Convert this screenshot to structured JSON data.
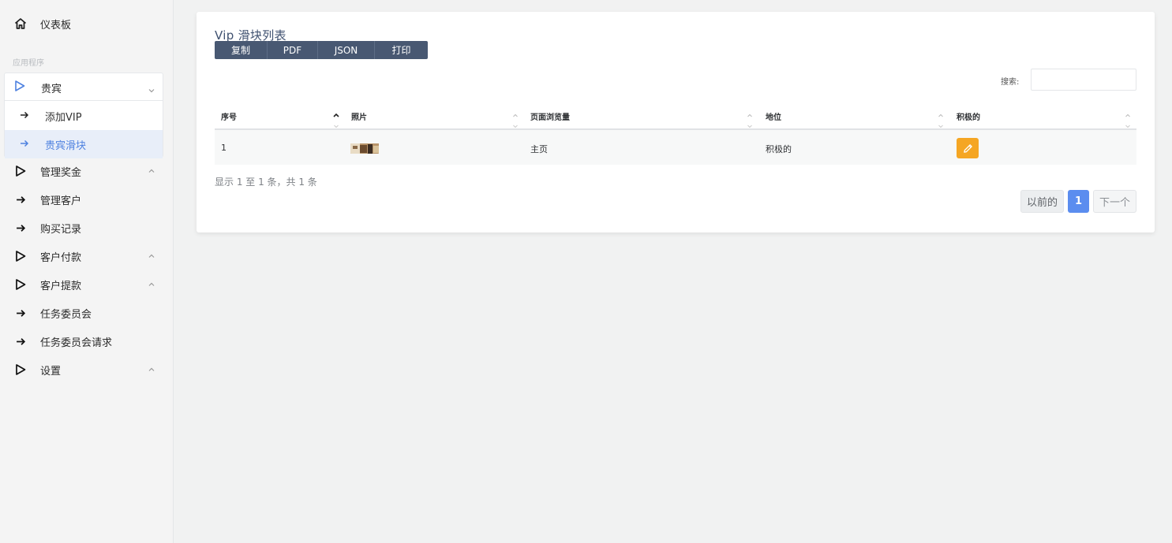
{
  "sidebar": {
    "dashboard": "仪表板",
    "section_label": "应用程序",
    "vip": {
      "label": "贵宾",
      "children": [
        "添加VIP",
        "贵宾滑块"
      ]
    },
    "items": [
      {
        "label": "管理奖金",
        "icon": "play-icon",
        "chevron": true
      },
      {
        "label": "管理客户",
        "icon": "arrow-right-icon",
        "chevron": false
      },
      {
        "label": "购买记录",
        "icon": "arrow-right-icon",
        "chevron": false
      },
      {
        "label": "客户付款",
        "icon": "play-icon",
        "chevron": true
      },
      {
        "label": "客户提款",
        "icon": "play-icon",
        "chevron": true
      },
      {
        "label": "任务委员会",
        "icon": "arrow-right-icon",
        "chevron": false
      },
      {
        "label": "任务委员会请求",
        "icon": "arrow-right-icon",
        "chevron": false
      },
      {
        "label": "设置",
        "icon": "play-icon",
        "chevron": true
      }
    ]
  },
  "card": {
    "title": "Vip 滑块列表",
    "export_buttons": [
      "复制",
      "PDF",
      "JSON",
      "打印"
    ],
    "search_label": "搜索:",
    "search_value": ""
  },
  "table": {
    "columns": [
      "序号",
      "照片",
      "页面浏览量",
      "地位",
      "积极的"
    ],
    "rows": [
      {
        "index": "1",
        "page": "主页",
        "status": "积极的"
      }
    ],
    "info": "显示 1 至 1 条，共 1 条"
  },
  "pagination": {
    "prev": "以前的",
    "current": "1",
    "next": "下一个"
  },
  "colors": {
    "accent": "#5b8def",
    "button_dark": "#485872",
    "edit": "#f5a623",
    "active_bg": "#e8eef9"
  }
}
